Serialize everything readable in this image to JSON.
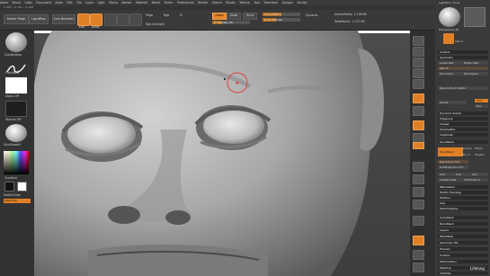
{
  "menubar": {
    "items": [
      "Alpha",
      "Brush",
      "Color",
      "Document",
      "Draw",
      "Edit",
      "File",
      "Layer",
      "Light",
      "Macro",
      "Marker",
      "Material",
      "Movie",
      "Picker",
      "Preferences",
      "Render",
      "Stencil",
      "Stroke",
      "Texture",
      "Tool",
      "Transform",
      "Zplugin",
      "Zscript"
    ],
    "right_items": [
      "ZBrush 4R8",
      "Menus",
      "DefaultZScript"
    ]
  },
  "infobar": {
    "text": "0.482 • 0.765 • 4.268"
  },
  "toolbar": {
    "home_page": "Home Page",
    "lightbox": "LightBox",
    "live_boolean": "Live Boolean",
    "edit": "Edit",
    "draw": "Draw",
    "move": "Move",
    "scale": "Scale",
    "rotate": "Rotate",
    "mrgb": "Mrgb",
    "rgb": "Rgb",
    "m": "M",
    "zadd": "Zadd",
    "zsub": "Zsub",
    "zcut": "Zcut",
    "focal_shift": "Focal Shift 0",
    "draw_size": "Draw Size 64",
    "z_intensity": "Z Intensity 25",
    "rgb_intensity": "Rgb Intensity",
    "active_points": "ActivePoints: 1.156 Mil",
    "total_points": "TotalPoints: 1.172 Mil",
    "dynamic": "Dynamic"
  },
  "sliders": {
    "draw_size": 0.35,
    "z_intensity": 0.25,
    "focal_shift": 0.5
  },
  "left_shelf": {
    "brush": "ClayBuildup",
    "stroke": "FreeHand",
    "alpha": "Alpha Off",
    "texture": "Texture Off",
    "material": "SkinShade4",
    "gradient": "Gradient",
    "switch_color": "SwitchColor",
    "alternate": "Alternate"
  },
  "tray": {
    "title": "LightBox• Tools",
    "polysphere": "PolySphere_48",
    "spix": "SPix 3",
    "subtool": "Subtool",
    "geometry": "Geometry",
    "lower_res": "Lower Res",
    "higher_res": "Higher Res",
    "sdiv": "SDiv 5",
    "del_lower": "Del Lower",
    "del_higher": "Del Higher",
    "reconstruct": "Reconstruct Subdiv",
    "divide": "Divide",
    "smt": "Smt",
    "suv": "Suv",
    "rsmt": "ReUV",
    "dynamic_subdiv": "Dynamic Subdiv",
    "edgeloop": "EdgeLoop",
    "crease": "Crease",
    "shadowbox": "ShadowBox",
    "claypolish": "ClayPolish",
    "dynamesh": "DynaMesh",
    "dynamesh_btn": "DynaMesh",
    "groups": "Groups",
    "polish": "Polish",
    "blur": "Blur 2",
    "project": "Project",
    "resolution": "Resolution 512",
    "subprojection": "SubProjection 0.6",
    "add": "Add",
    "sub": "Sub",
    "and": "And",
    "create_shell": "Create Shell",
    "thickness": "Thickness 4",
    "zremesher": "ZRemesher",
    "modify_topology": "Modify Topology",
    "position": "Position",
    "size": "Size",
    "meshintegrity": "MeshIntegrity",
    "arraymesh": "ArrayMesh",
    "nanomesh": "NanoMesh",
    "layers": "Layers",
    "fibermesh": "FiberMesh",
    "geometry_hd": "Geometry HD",
    "preview": "Preview",
    "surface": "Surface",
    "deformation": "Deformation",
    "masking": "Masking",
    "visibility": "Visibility"
  },
  "watermark": "Lifelong"
}
